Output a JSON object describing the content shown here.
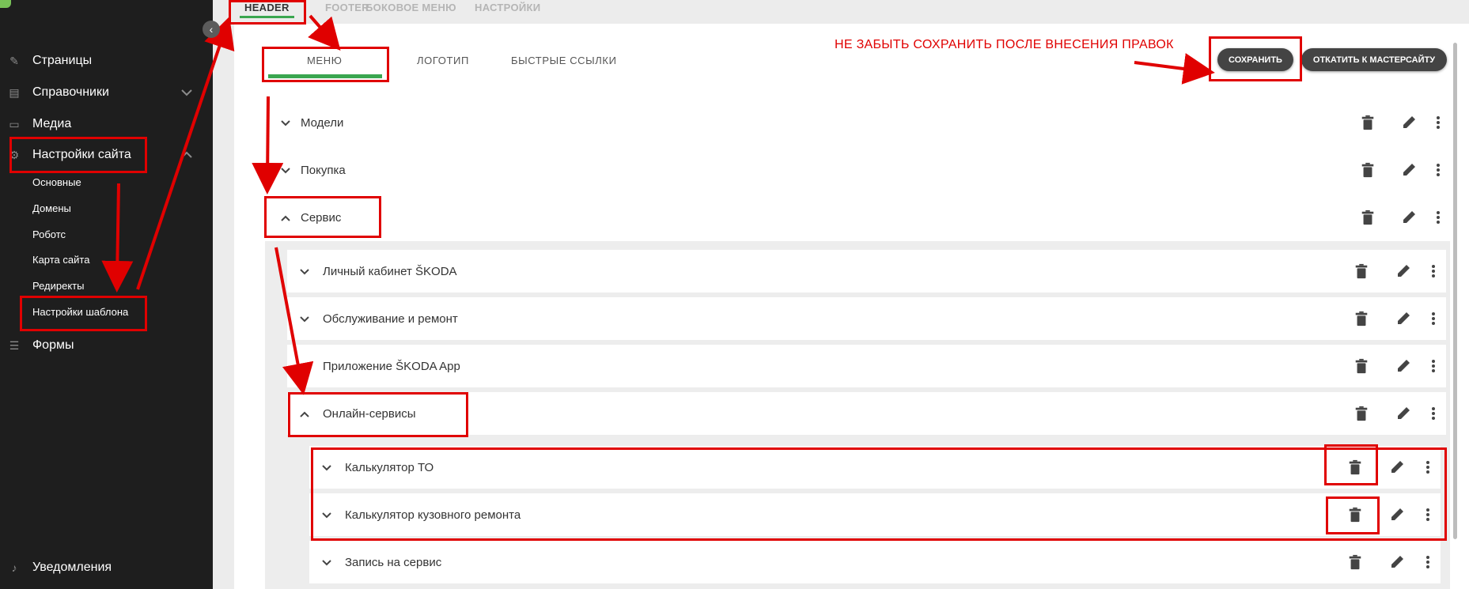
{
  "sidebar": {
    "collapse_icon": "‹",
    "items": [
      {
        "label": "Страницы",
        "icon": "pencil-icon"
      },
      {
        "label": "Справочники",
        "icon": "document-icon"
      },
      {
        "label": "Медиа",
        "icon": "folder-icon"
      },
      {
        "label": "Настройки сайта",
        "icon": "gear-icon"
      },
      {
        "label": "Формы",
        "icon": "list-icon"
      },
      {
        "label": "Уведомления",
        "icon": "bell-icon"
      }
    ],
    "sub_items": [
      "Основные",
      "Домены",
      "Роботс",
      "Карта сайта",
      "Редиректы",
      "Настройки шаблона"
    ]
  },
  "top_tabs": [
    "HEADER",
    "FOOTER",
    "БОКОВОЕ МЕНЮ",
    "НАСТРОЙКИ"
  ],
  "sub_tabs": [
    "МЕНЮ",
    "ЛОГОТИП",
    "БЫСТРЫЕ ССЫЛКИ"
  ],
  "buttons": {
    "save": "СОХРАНИТЬ",
    "rollback": "ОТКАТИТЬ К МАСТЕРСАЙТУ"
  },
  "annotation_note": "НЕ ЗАБЫТЬ СОХРАНИТЬ ПОСЛЕ ВНЕСЕНИЯ ПРАВОК",
  "menu_rows": {
    "level1": [
      "Модели",
      "Покупка",
      "Сервис"
    ],
    "level2": [
      "Личный кабинет ŠKODA",
      "Обслуживание и ремонт",
      "Приложение ŠKODA App",
      "Онлайн-сервисы"
    ],
    "level3": [
      "Калькулятор ТО",
      "Калькулятор кузовного ремонта",
      "Запись на сервис"
    ]
  },
  "colors": {
    "accent": "#3aa64f",
    "annotation": "#e00000",
    "sidebar_bg": "#1e1e1e",
    "button_bg": "#444444"
  }
}
